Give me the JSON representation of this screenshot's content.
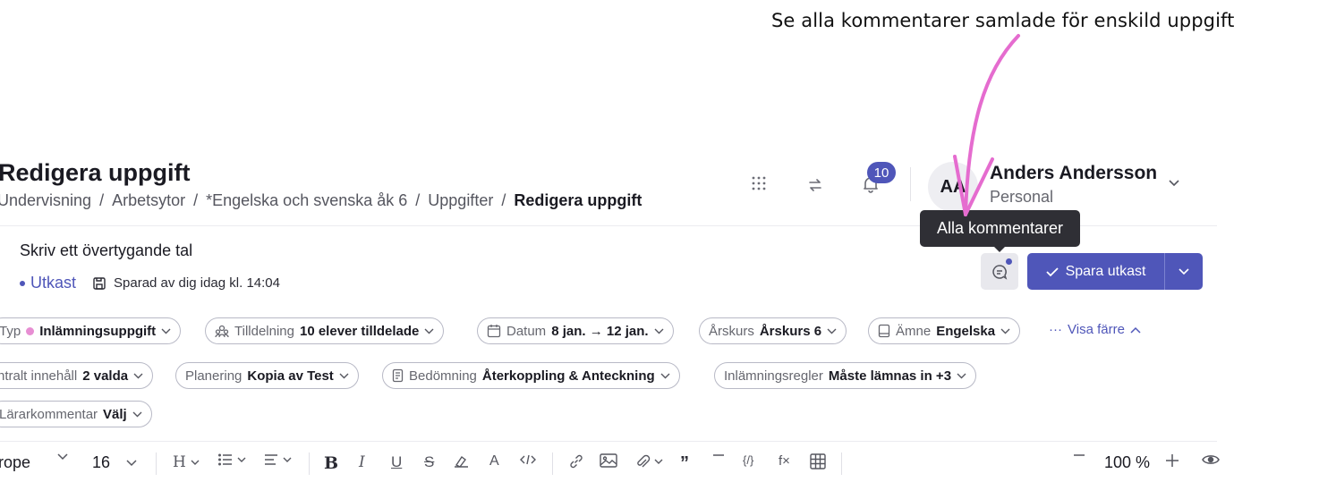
{
  "annotation": {
    "text": "Se alla kommentarer samlade för enskild uppgift"
  },
  "header": {
    "title": "Redigera uppgift",
    "breadcrumb": [
      "Undervisning",
      "Arbetsytor",
      "*Engelska och svenska åk 6",
      "Uppgifter",
      "Redigera uppgift"
    ],
    "notifications_count": "10",
    "user": {
      "initials": "AA",
      "name": "Anders Andersson",
      "role": "Personal"
    }
  },
  "task": {
    "title": "Skriv ett övertygande tal",
    "status": "Utkast",
    "saved_text": "Sparad av dig idag kl. 14:04"
  },
  "actions": {
    "tooltip": "Alla kommentarer",
    "save_label": "Spara utkast"
  },
  "chips": {
    "typ": {
      "label": "Typ",
      "value": "Inlämningsuppgift"
    },
    "tilldelning": {
      "label": "Tilldelning",
      "value": "10 elever tilldelade"
    },
    "datum": {
      "label": "Datum",
      "value": "8 jan. → 12 jan."
    },
    "arskurs": {
      "label": "Årskurs",
      "value": "Årskurs 6"
    },
    "amne": {
      "label": "Ämne",
      "value": "Engelska"
    },
    "show_less": "Visa färre",
    "centralt": {
      "label": "ntralt innehåll",
      "value": "2 valda"
    },
    "planering": {
      "label": "Planering",
      "value": "Kopia av Test"
    },
    "bedomning": {
      "label": "Bedömning",
      "value": "Återkoppling & Anteckning"
    },
    "inlamning": {
      "label": "Inlämningsregler",
      "value": "Måste lämnas in +3"
    },
    "lararkommentar": {
      "label": "Lärarkommentar",
      "value": "Välj"
    }
  },
  "toolbar": {
    "font": "rope",
    "size": "16",
    "zoom": "100 %"
  },
  "colors": {
    "accent": "#4f56b9",
    "arrow": "#e56ccf",
    "tooltip_bg": "#2f2f35"
  }
}
